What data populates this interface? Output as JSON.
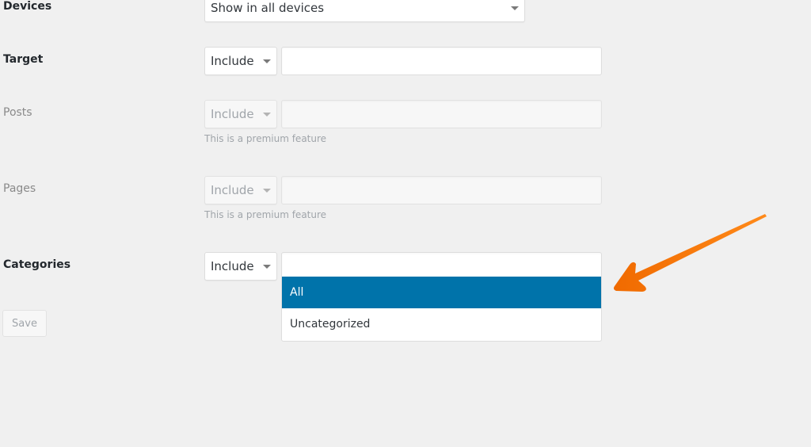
{
  "devices": {
    "label": "Devices",
    "selected": "Show in all devices"
  },
  "target": {
    "label": "Target",
    "mode": "Include",
    "value": ""
  },
  "posts": {
    "label": "Posts",
    "mode": "Include",
    "value": "",
    "hint": "This is a premium feature",
    "disabled": true
  },
  "pages": {
    "label": "Pages",
    "mode": "Include",
    "value": "",
    "hint": "This is a premium feature",
    "disabled": true
  },
  "categories": {
    "label": "Categories",
    "mode": "Include",
    "search_value": "",
    "options": [
      {
        "label": "All",
        "highlighted": true
      },
      {
        "label": "Uncategorized",
        "highlighted": false
      }
    ]
  },
  "actions": {
    "save_label": "Save"
  },
  "colors": {
    "highlight": "#0073aa",
    "annotation_arrow": "#f47a0c",
    "background": "#f0f0f0"
  }
}
